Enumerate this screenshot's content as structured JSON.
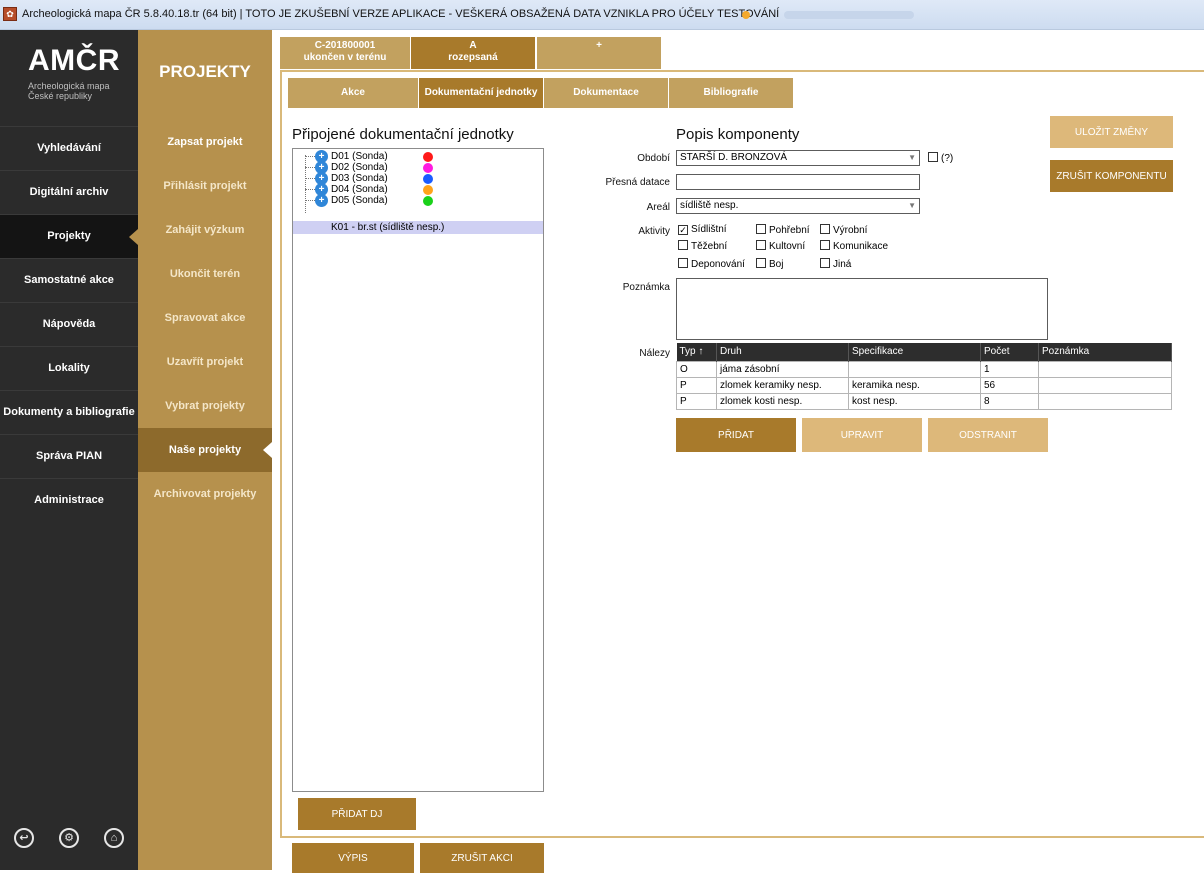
{
  "window": {
    "title": "Archeologická mapa ČR 5.8.40.18.tr (64 bit) | TOTO JE ZKUŠEBNÍ VERZE APLIKACE - VEŠKERÁ OBSAŽENÁ DATA VZNIKLA PRO ÚČELY TESTOVÁNÍ"
  },
  "logo": {
    "title": "AMČR",
    "sub1": "Archeologická mapa",
    "sub2": "České republiky"
  },
  "nav": {
    "items": [
      {
        "label": "Vyhledávání"
      },
      {
        "label": "Digitální archiv"
      },
      {
        "label": "Projekty"
      },
      {
        "label": "Samostatné akce"
      },
      {
        "label": "Nápověda"
      },
      {
        "label": "Lokality"
      },
      {
        "label": "Dokumenty a bibliografie"
      },
      {
        "label": "Správa PIAN"
      },
      {
        "label": "Administrace"
      }
    ],
    "active": "Projekty"
  },
  "sub": {
    "heading": "PROJEKTY",
    "items": [
      {
        "label": "Zapsat projekt"
      },
      {
        "label": "Přihlásit projekt"
      },
      {
        "label": "Zahájit výzkum"
      },
      {
        "label": "Ukončit terén"
      },
      {
        "label": "Spravovat akce"
      },
      {
        "label": "Uzavřít projekt"
      },
      {
        "label": "Vybrat projekty"
      },
      {
        "label": "Naše projekty"
      },
      {
        "label": "Archivovat projekty"
      }
    ],
    "active": "Naše projekty"
  },
  "top_tabs": [
    {
      "line1": "C-201800001",
      "line2": "ukončen v terénu"
    },
    {
      "line1": "A",
      "line2": "rozepsaná"
    },
    {
      "line1": "+",
      "line2": ""
    }
  ],
  "sec_tabs": [
    {
      "label": "Akce"
    },
    {
      "label": "Dokumentační jednotky"
    },
    {
      "label": "Dokumentace"
    },
    {
      "label": "Bibliografie"
    }
  ],
  "tree": {
    "title": "Připojené dokumentační jednotky",
    "nodes": [
      {
        "label": "D01 (Sonda)",
        "color": "#ff1a1a"
      },
      {
        "label": "D02 (Sonda)",
        "color": "#ff1ae0"
      },
      {
        "label": "D03 (Sonda)",
        "color": "#1a5cff"
      },
      {
        "label": "D04 (Sonda)",
        "color": "#ffa31a"
      },
      {
        "label": "D05 (Sonda)",
        "color": "#1ad11a"
      }
    ],
    "child": "K01 - br.st (sídliště nesp.)",
    "add_button": "PŘIDAT DJ"
  },
  "form": {
    "title": "Popis komponenty",
    "period_label": "Období",
    "period_value": "STARŠÍ D. BRONZOVÁ",
    "period_hint": "(?)",
    "dating_label": "Přesná datace",
    "dating_value": "",
    "area_label": "Areál",
    "area_value": "sídliště nesp.",
    "activities_label": "Aktivity",
    "activities": [
      {
        "label": "Sídlištní",
        "checked": true
      },
      {
        "label": "Pohřební",
        "checked": false
      },
      {
        "label": "Výrobní",
        "checked": false
      },
      {
        "label": "Těžební",
        "checked": false
      },
      {
        "label": "Kultovní",
        "checked": false
      },
      {
        "label": "Komunikace",
        "checked": false
      },
      {
        "label": "Deponování",
        "checked": false
      },
      {
        "label": "Boj",
        "checked": false
      },
      {
        "label": "Jiná",
        "checked": false
      }
    ],
    "note_label": "Poznámka",
    "finds_label": "Nálezy"
  },
  "finds": {
    "columns": [
      "Typ ↑",
      "Druh",
      "Specifikace",
      "Počet",
      "Poznámka"
    ],
    "rows": [
      [
        "O",
        "jáma zásobní",
        "",
        "1",
        ""
      ],
      [
        "P",
        "zlomek keramiky nesp.",
        "keramika nesp.",
        "56",
        ""
      ],
      [
        "P",
        "zlomek kosti nesp.",
        "kost nesp.",
        "8",
        ""
      ]
    ]
  },
  "buttons": {
    "save": "ULOŽIT ZMĚNY",
    "cancel_component": "ZRUŠIT KOMPONENTU",
    "add": "PŘIDAT",
    "edit": "UPRAVIT",
    "remove": "ODSTRANIT",
    "list": "VÝPIS",
    "cancel_action": "ZRUŠIT AKCI"
  },
  "colors": {
    "nav_bg": "#2b2b2b",
    "accent": "#b6914d",
    "button_dark": "#a87a2b",
    "button_light": "#ddb87a"
  }
}
